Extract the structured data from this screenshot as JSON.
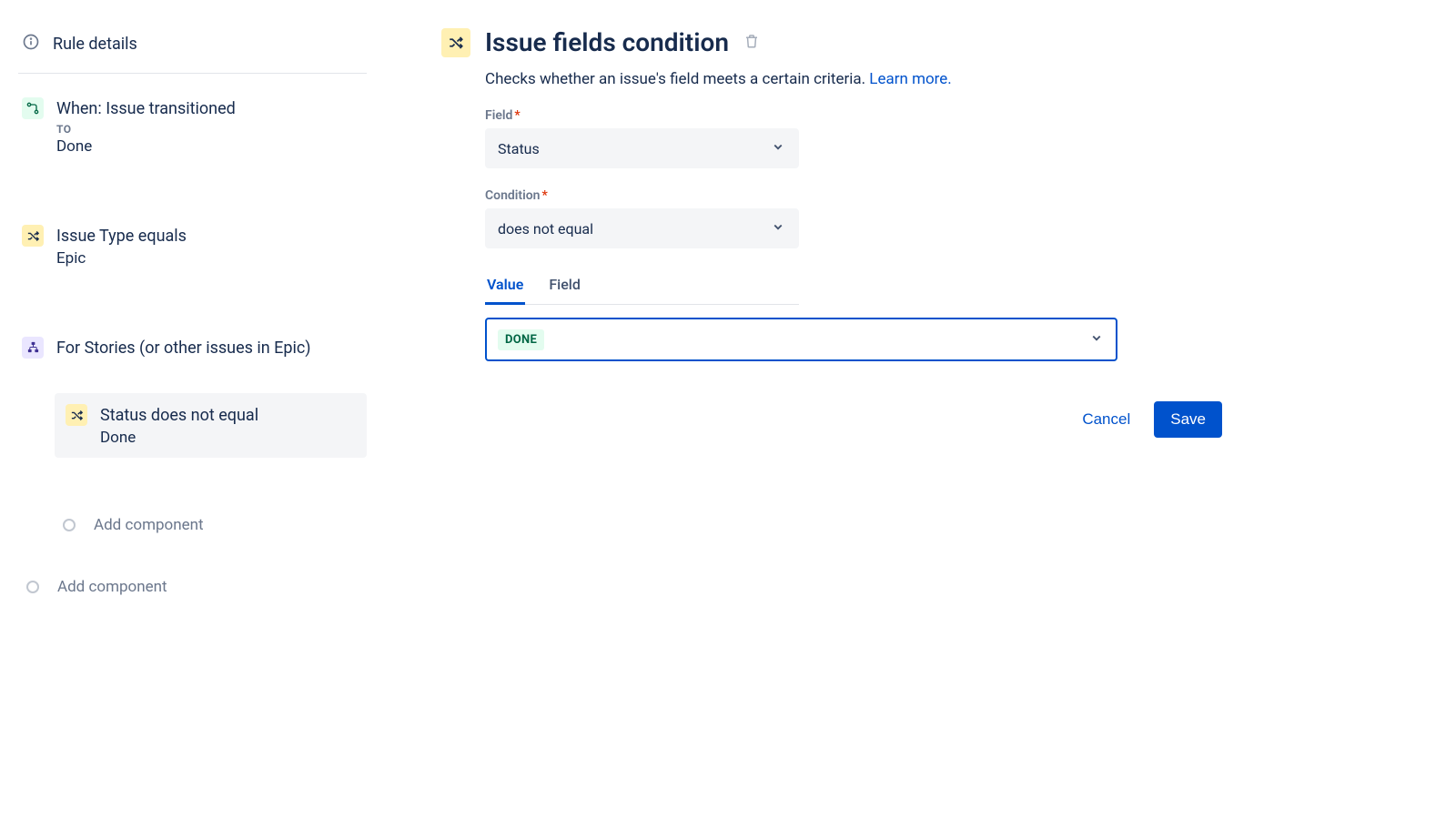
{
  "sidebar": {
    "header": "Rule details",
    "nodes": {
      "trigger": {
        "title": "When: Issue transitioned",
        "sublabel": "TO",
        "subvalue": "Done"
      },
      "cond1": {
        "title": "Issue Type equals",
        "subvalue": "Epic"
      },
      "branch": {
        "title": "For Stories (or other issues in Epic)"
      },
      "cond2": {
        "title": "Status does not equal",
        "subvalue": "Done"
      }
    },
    "add_label_inner": "Add component",
    "add_label_outer": "Add component"
  },
  "main": {
    "title": "Issue fields condition",
    "description": "Checks whether an issue's field meets a certain criteria. ",
    "learn_more": "Learn more.",
    "field_label": "Field",
    "field_value": "Status",
    "condition_label": "Condition",
    "condition_value": "does not equal",
    "tabs": {
      "value": "Value",
      "field": "Field"
    },
    "selected_value": "DONE",
    "cancel": "Cancel",
    "save": "Save"
  }
}
